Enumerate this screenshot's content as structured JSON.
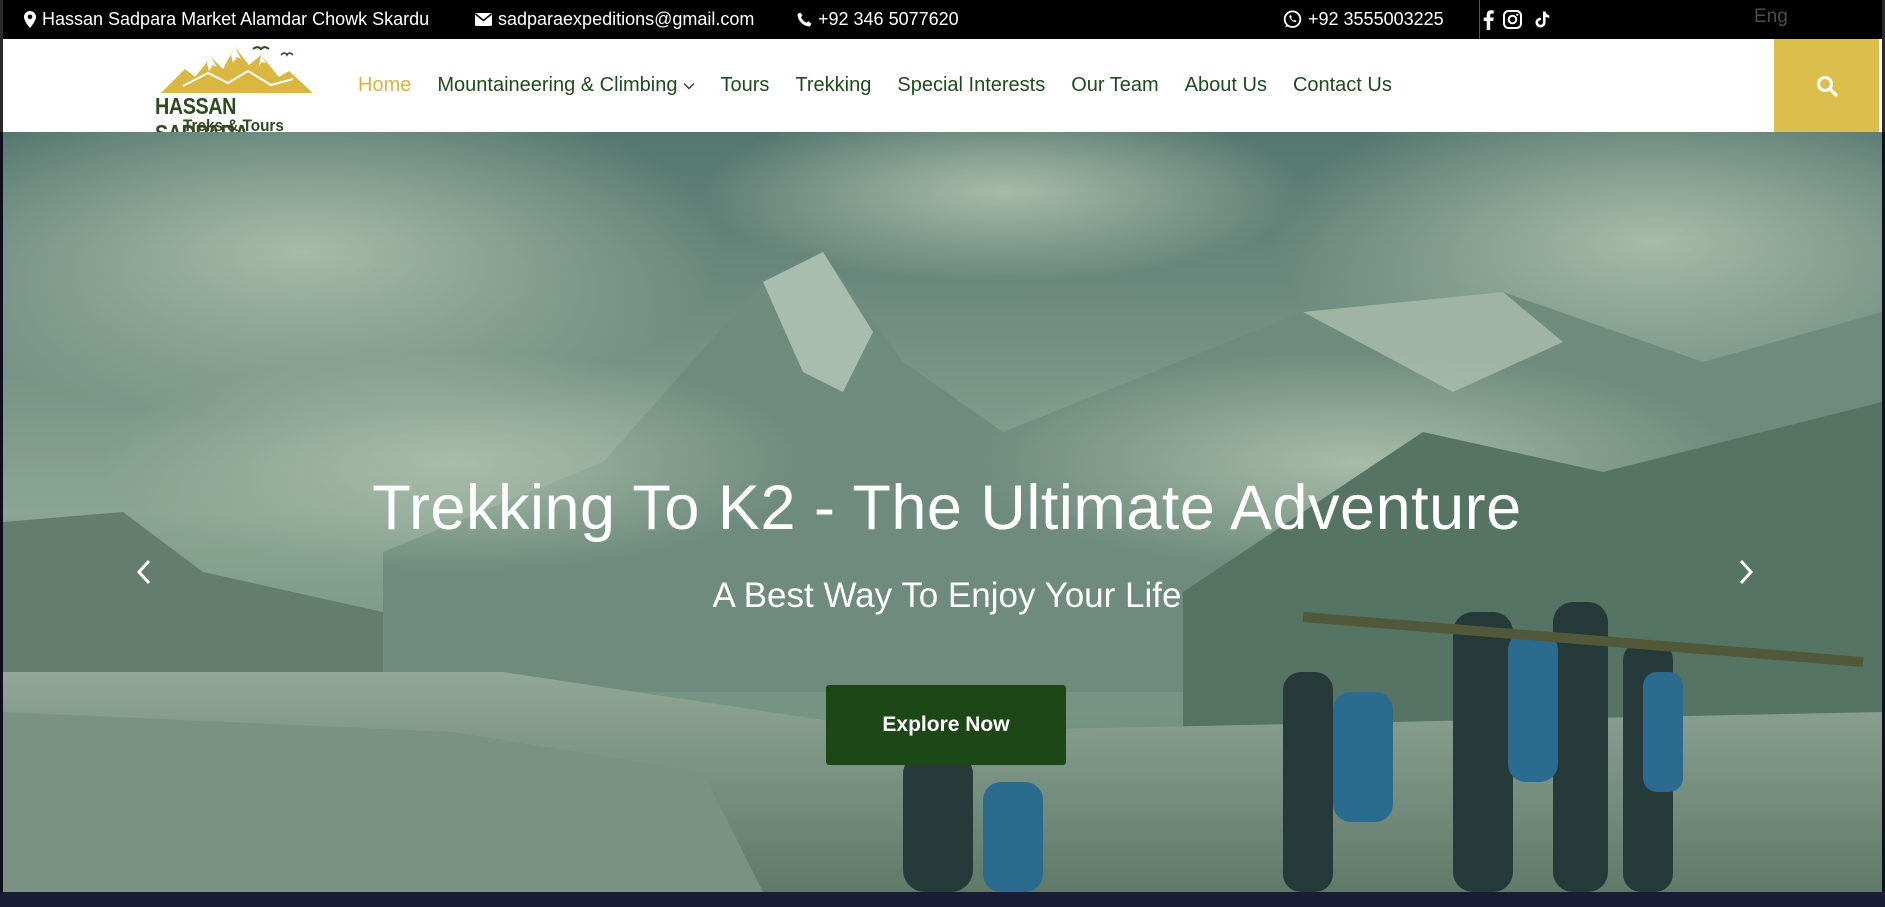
{
  "topbar": {
    "address": "Hassan Sadpara Market Alamdar Chowk Skardu",
    "email": "sadparaexpeditions@gmail.com",
    "phone": "+92 346 5077620",
    "whatsapp": "+92 3555003225",
    "language": "Eng",
    "icons": [
      "map-marker-icon",
      "envelope-icon",
      "phone-icon",
      "whatsapp-icon",
      "facebook-icon",
      "instagram-icon",
      "tiktok-icon"
    ]
  },
  "brand": {
    "logo_title": "HASSAN SADPARA",
    "logo_subtitle": "Treks & Tours",
    "colors": {
      "gold": "#dbbe4c",
      "green": "#1e4717",
      "nav_text": "#1f4a1f",
      "active": "#d4b442"
    }
  },
  "nav": {
    "items": [
      {
        "label": "Home",
        "active": true
      },
      {
        "label": "Mountaineering & Climbing",
        "dropdown": true
      },
      {
        "label": "Tours"
      },
      {
        "label": "Trekking"
      },
      {
        "label": "Special Interests"
      },
      {
        "label": "Our Team"
      },
      {
        "label": "About Us"
      },
      {
        "label": "Contact Us"
      }
    ],
    "search_icon": "search-icon"
  },
  "hero": {
    "title": "Trekking To K2 - The Ultimate Adventure",
    "subtitle": "A Best Way To Enjoy Your Life",
    "button": "Explore Now",
    "prev_icon": "chevron-left-icon",
    "next_icon": "chevron-right-icon"
  }
}
